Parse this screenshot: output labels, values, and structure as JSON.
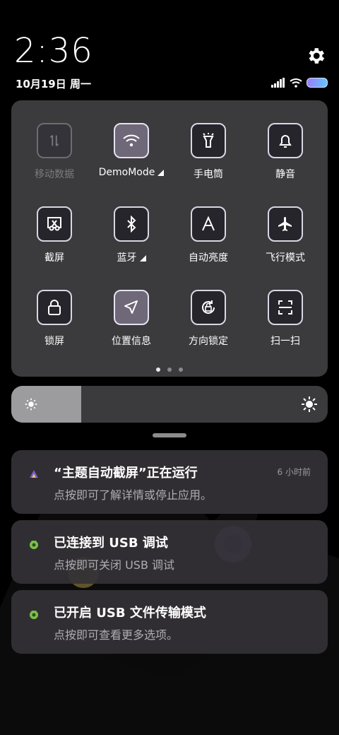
{
  "status": {
    "time": "2:36",
    "date": "10月19日 周一",
    "icons": [
      "signal-icon",
      "wifi-icon",
      "battery-icon"
    ]
  },
  "colors": {
    "panel": "#3b3a3c",
    "tile_on": "#6f6878",
    "tile_off": "#26252b",
    "battery_gradient_start": "#9a7cff",
    "battery_gradient_end": "#63c4ff"
  },
  "tiles": [
    {
      "label": "移动数据",
      "icon": "mobile-data-icon",
      "state": "disabled"
    },
    {
      "label": "DemoMode",
      "icon": "wifi-icon",
      "state": "on",
      "expandable": true
    },
    {
      "label": "手电筒",
      "icon": "flashlight-icon",
      "state": "off"
    },
    {
      "label": "静音",
      "icon": "bell-icon",
      "state": "off"
    },
    {
      "label": "截屏",
      "icon": "screenshot-icon",
      "state": "off"
    },
    {
      "label": "蓝牙",
      "icon": "bluetooth-icon",
      "state": "off",
      "expandable": true
    },
    {
      "label": "自动亮度",
      "icon": "auto-brightness-icon",
      "state": "off"
    },
    {
      "label": "飞行模式",
      "icon": "airplane-icon",
      "state": "off"
    },
    {
      "label": "锁屏",
      "icon": "lock-icon",
      "state": "off"
    },
    {
      "label": "位置信息",
      "icon": "location-icon",
      "state": "on"
    },
    {
      "label": "方向锁定",
      "icon": "rotation-lock-icon",
      "state": "off"
    },
    {
      "label": "扫一扫",
      "icon": "scan-icon",
      "state": "off"
    }
  ],
  "pager": {
    "pages": 3,
    "current": 1
  },
  "brightness": {
    "level": 0.22
  },
  "notifications": [
    {
      "icon": "theme-app-icon",
      "title": "“主题自动截屏”正在运行",
      "body": "点按即可了解详情或停止应用。",
      "time": "6 小时前"
    },
    {
      "icon": "android-debug-icon",
      "title": "已连接到 USB 调试",
      "body": "点按即可关闭 USB 调试",
      "time": ""
    },
    {
      "icon": "android-debug-icon",
      "title": "已开启 USB 文件传输模式",
      "body": "点按即可查看更多选项。",
      "time": ""
    }
  ]
}
